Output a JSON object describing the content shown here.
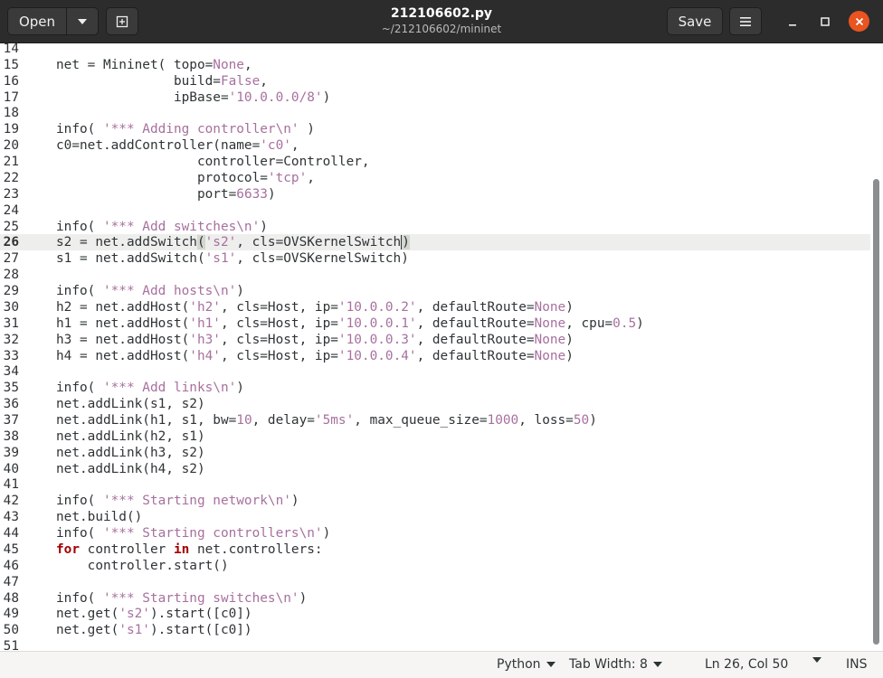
{
  "header": {
    "open_label": "Open",
    "save_label": "Save",
    "title": "212106602.py",
    "subtitle": "~/212106602/mininet"
  },
  "editor": {
    "current_line": 26,
    "lines": [
      {
        "n": "14",
        "t": [
          {
            "x": ""
          }
        ]
      },
      {
        "n": "15",
        "t": [
          {
            "x": "net = Mininet( topo="
          },
          {
            "x": "None",
            "c": "c"
          },
          {
            "x": ","
          }
        ]
      },
      {
        "n": "16",
        "t": [
          {
            "x": "               build="
          },
          {
            "x": "False",
            "c": "c"
          },
          {
            "x": ","
          }
        ]
      },
      {
        "n": "17",
        "t": [
          {
            "x": "               ipBase="
          },
          {
            "x": "'10.0.0.0/8'",
            "c": "s"
          },
          {
            "x": ")"
          }
        ]
      },
      {
        "n": "18",
        "t": [
          {
            "x": ""
          }
        ]
      },
      {
        "n": "19",
        "t": [
          {
            "x": "info( "
          },
          {
            "x": "'*** Adding controller\\n'",
            "c": "s"
          },
          {
            "x": " )"
          }
        ]
      },
      {
        "n": "20",
        "t": [
          {
            "x": "c0=net.addController(name="
          },
          {
            "x": "'c0'",
            "c": "s"
          },
          {
            "x": ","
          }
        ]
      },
      {
        "n": "21",
        "t": [
          {
            "x": "                  controller=Controller,"
          }
        ]
      },
      {
        "n": "22",
        "t": [
          {
            "x": "                  protocol="
          },
          {
            "x": "'tcp'",
            "c": "s"
          },
          {
            "x": ","
          }
        ]
      },
      {
        "n": "23",
        "t": [
          {
            "x": "                  port="
          },
          {
            "x": "6633",
            "c": "c"
          },
          {
            "x": ")"
          }
        ]
      },
      {
        "n": "24",
        "t": [
          {
            "x": ""
          }
        ]
      },
      {
        "n": "25",
        "t": [
          {
            "x": "info( "
          },
          {
            "x": "'*** Add switches\\n'",
            "c": "s"
          },
          {
            "x": ")"
          }
        ]
      },
      {
        "n": "26",
        "t": [
          {
            "x": "s2 = net.addSwitch"
          },
          {
            "x": "(",
            "c": "hl"
          },
          {
            "x": "'s2'",
            "c": "s"
          },
          {
            "x": ", cls=OVSKernelSwitch"
          },
          {
            "x": "CURSOR",
            "c": "cursor"
          },
          {
            "x": ")",
            "c": "hl"
          }
        ]
      },
      {
        "n": "27",
        "t": [
          {
            "x": "s1 = net.addSwitch("
          },
          {
            "x": "'s1'",
            "c": "s"
          },
          {
            "x": ", cls=OVSKernelSwitch)"
          }
        ]
      },
      {
        "n": "28",
        "t": [
          {
            "x": ""
          }
        ]
      },
      {
        "n": "29",
        "t": [
          {
            "x": "info( "
          },
          {
            "x": "'*** Add hosts\\n'",
            "c": "s"
          },
          {
            "x": ")"
          }
        ]
      },
      {
        "n": "30",
        "t": [
          {
            "x": "h2 = net.addHost("
          },
          {
            "x": "'h2'",
            "c": "s"
          },
          {
            "x": ", cls=Host, ip="
          },
          {
            "x": "'10.0.0.2'",
            "c": "s"
          },
          {
            "x": ", defaultRoute="
          },
          {
            "x": "None",
            "c": "c"
          },
          {
            "x": ")"
          }
        ]
      },
      {
        "n": "31",
        "t": [
          {
            "x": "h1 = net.addHost("
          },
          {
            "x": "'h1'",
            "c": "s"
          },
          {
            "x": ", cls=Host, ip="
          },
          {
            "x": "'10.0.0.1'",
            "c": "s"
          },
          {
            "x": ", defaultRoute="
          },
          {
            "x": "None",
            "c": "c"
          },
          {
            "x": ", cpu="
          },
          {
            "x": "0.5",
            "c": "c"
          },
          {
            "x": ")"
          }
        ]
      },
      {
        "n": "32",
        "t": [
          {
            "x": "h3 = net.addHost("
          },
          {
            "x": "'h3'",
            "c": "s"
          },
          {
            "x": ", cls=Host, ip="
          },
          {
            "x": "'10.0.0.3'",
            "c": "s"
          },
          {
            "x": ", defaultRoute="
          },
          {
            "x": "None",
            "c": "c"
          },
          {
            "x": ")"
          }
        ]
      },
      {
        "n": "33",
        "t": [
          {
            "x": "h4 = net.addHost("
          },
          {
            "x": "'h4'",
            "c": "s"
          },
          {
            "x": ", cls=Host, ip="
          },
          {
            "x": "'10.0.0.4'",
            "c": "s"
          },
          {
            "x": ", defaultRoute="
          },
          {
            "x": "None",
            "c": "c"
          },
          {
            "x": ")"
          }
        ]
      },
      {
        "n": "34",
        "t": [
          {
            "x": ""
          }
        ]
      },
      {
        "n": "35",
        "t": [
          {
            "x": "info( "
          },
          {
            "x": "'*** Add links\\n'",
            "c": "s"
          },
          {
            "x": ")"
          }
        ]
      },
      {
        "n": "36",
        "t": [
          {
            "x": "net.addLink(s1, s2)"
          }
        ]
      },
      {
        "n": "37",
        "t": [
          {
            "x": "net.addLink(h1, s1, bw="
          },
          {
            "x": "10",
            "c": "c"
          },
          {
            "x": ", delay="
          },
          {
            "x": "'5ms'",
            "c": "s"
          },
          {
            "x": ", max_queue_size="
          },
          {
            "x": "1000",
            "c": "c"
          },
          {
            "x": ", loss="
          },
          {
            "x": "50",
            "c": "c"
          },
          {
            "x": ")"
          }
        ]
      },
      {
        "n": "38",
        "t": [
          {
            "x": "net.addLink(h2, s1)"
          }
        ]
      },
      {
        "n": "39",
        "t": [
          {
            "x": "net.addLink(h3, s2)"
          }
        ]
      },
      {
        "n": "40",
        "t": [
          {
            "x": "net.addLink(h4, s2)"
          }
        ]
      },
      {
        "n": "41",
        "t": [
          {
            "x": ""
          }
        ]
      },
      {
        "n": "42",
        "t": [
          {
            "x": "info( "
          },
          {
            "x": "'*** Starting network\\n'",
            "c": "s"
          },
          {
            "x": ")"
          }
        ]
      },
      {
        "n": "43",
        "t": [
          {
            "x": "net.build()"
          }
        ]
      },
      {
        "n": "44",
        "t": [
          {
            "x": "info( "
          },
          {
            "x": "'*** Starting controllers\\n'",
            "c": "s"
          },
          {
            "x": ")"
          }
        ]
      },
      {
        "n": "45",
        "t": [
          {
            "x": "for",
            "c": "kw"
          },
          {
            "x": " controller "
          },
          {
            "x": "in",
            "c": "kw"
          },
          {
            "x": " net.controllers:"
          }
        ]
      },
      {
        "n": "46",
        "t": [
          {
            "x": "    controller.start()"
          }
        ]
      },
      {
        "n": "47",
        "t": [
          {
            "x": ""
          }
        ]
      },
      {
        "n": "48",
        "t": [
          {
            "x": "info( "
          },
          {
            "x": "'*** Starting switches\\n'",
            "c": "s"
          },
          {
            "x": ")"
          }
        ]
      },
      {
        "n": "49",
        "t": [
          {
            "x": "net.get("
          },
          {
            "x": "'s2'",
            "c": "s"
          },
          {
            "x": ").start([c0])"
          }
        ]
      },
      {
        "n": "50",
        "t": [
          {
            "x": "net.get("
          },
          {
            "x": "'s1'",
            "c": "s"
          },
          {
            "x": ").start([c0])"
          }
        ]
      },
      {
        "n": "51",
        "t": [
          {
            "x": ""
          }
        ]
      }
    ]
  },
  "statusbar": {
    "language": "Python",
    "tab_width": "Tab Width: 8",
    "position": "Ln 26, Col 50",
    "mode": "INS"
  },
  "colors": {
    "header_bg": "#2c2c2c",
    "close_button": "#e95420",
    "string": "#a7709e",
    "keyword": "#a40000",
    "current_line_bg": "#eeeeec"
  }
}
